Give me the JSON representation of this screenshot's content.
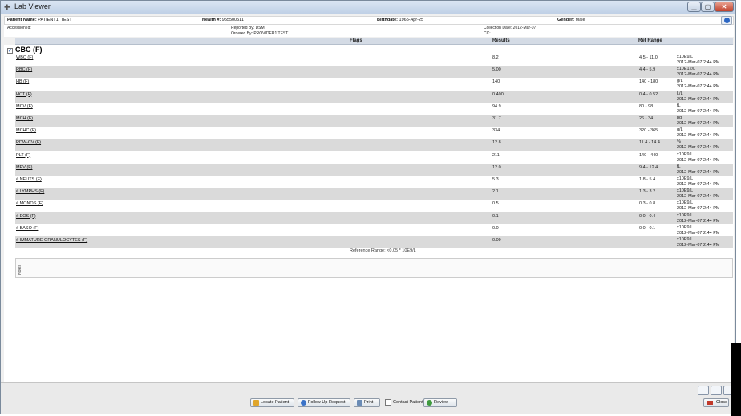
{
  "window": {
    "title": "Lab Viewer",
    "min": "▁",
    "max": "▢",
    "close": "✕"
  },
  "patient": {
    "name_label": "Patient Name:",
    "name": "PATIENT1, TEST",
    "health_label": "Health #:",
    "health": "955500511",
    "birth_label": "Birthdate:",
    "birth": "1965-Apr-25",
    "gender_label": "Gender:",
    "gender": "Male"
  },
  "meta": {
    "accession": "Accession Id:",
    "reported_by": "Reported By: DSM",
    "ordered_by": "Ordered By: PROVIDER1 TEST",
    "collection_date": "Collection Date: 2012-Mar-07",
    "cc": "CC:"
  },
  "columns": {
    "flags": "Flags",
    "results": "Results",
    "ref_range": "Ref Range"
  },
  "group": {
    "title": "CBC (F)",
    "check": "✓"
  },
  "rows": [
    {
      "test": "WBC (F)",
      "result": "8.2",
      "ref": "4.5 - 11.0",
      "unit": "x10E9/L",
      "date": "2012-Mar-07 2:44 PM"
    },
    {
      "test": "RBC (F)",
      "result": "5.00",
      "ref": "4.4 - 5.9",
      "unit": "x10E12/L",
      "date": "2012-Mar-07 2:44 PM"
    },
    {
      "test": "HB (F)",
      "result": "140",
      "ref": "140 - 180",
      "unit": "g/L",
      "date": "2012-Mar-07 2:44 PM"
    },
    {
      "test": "HCT (F)",
      "result": "0.400",
      "ref": "0.4 - 0.52",
      "unit": "L/L",
      "date": "2012-Mar-07 2:44 PM"
    },
    {
      "test": "MCV (F)",
      "result": "94.9",
      "ref": "80 - 98",
      "unit": "fL",
      "date": "2012-Mar-07 2:44 PM"
    },
    {
      "test": "MCH (F)",
      "result": "31.7",
      "ref": "26 - 34",
      "unit": "pg",
      "date": "2012-Mar-07 2:44 PM"
    },
    {
      "test": "MCHC (F)",
      "result": "334",
      "ref": "320 - 365",
      "unit": "g/L",
      "date": "2012-Mar-07 2:44 PM"
    },
    {
      "test": "RDW-CV (F)",
      "result": "12.8",
      "ref": "11.4 - 14.4",
      "unit": "%",
      "date": "2012-Mar-07 2:44 PM"
    },
    {
      "test": "PLT (F)",
      "result": "211",
      "ref": "140 - 440",
      "unit": "x10E9/L",
      "date": "2012-Mar-07 2:44 PM"
    },
    {
      "test": "MPV (F)",
      "result": "12.0",
      "ref": "9.4 - 12.4",
      "unit": "fL",
      "date": "2012-Mar-07 2:44 PM"
    },
    {
      "test": "# NEUTS (F)",
      "result": "5.3",
      "ref": "1.8 - 5.4",
      "unit": "x10E9/L",
      "date": "2012-Mar-07 2:44 PM"
    },
    {
      "test": "# LYMPHS (F)",
      "result": "2.1",
      "ref": "1.3 - 3.2",
      "unit": "x10E9/L",
      "date": "2012-Mar-07 2:44 PM"
    },
    {
      "test": "# MONOS (F)",
      "result": "0.5",
      "ref": "0.3 - 0.8",
      "unit": "x10E9/L",
      "date": "2012-Mar-07 2:44 PM"
    },
    {
      "test": "# EOS (F)",
      "result": "0.1",
      "ref": "0.0 - 0.4",
      "unit": "x10E9/L",
      "date": "2012-Mar-07 2:44 PM"
    },
    {
      "test": "# BASO (F)",
      "result": "0.0",
      "ref": "0.0 - 0.1",
      "unit": "x10E9/L",
      "date": "2012-Mar-07 2:44 PM"
    },
    {
      "test": "# IMMATURE GRANULOCYTES (F)",
      "result": "0.09",
      "ref": "",
      "unit": "x10E9/L",
      "date": "2012-Mar-07 2:44 PM"
    }
  ],
  "reference_note": "Reference Range:    <0.05 * 10E9/L",
  "notes_label": "Notes",
  "footer": {
    "locate": "Locate Patient",
    "follow_up": "Follow Up Request",
    "print": "Print",
    "contact": "Contact Patient",
    "review": "Review",
    "close": "Close"
  }
}
